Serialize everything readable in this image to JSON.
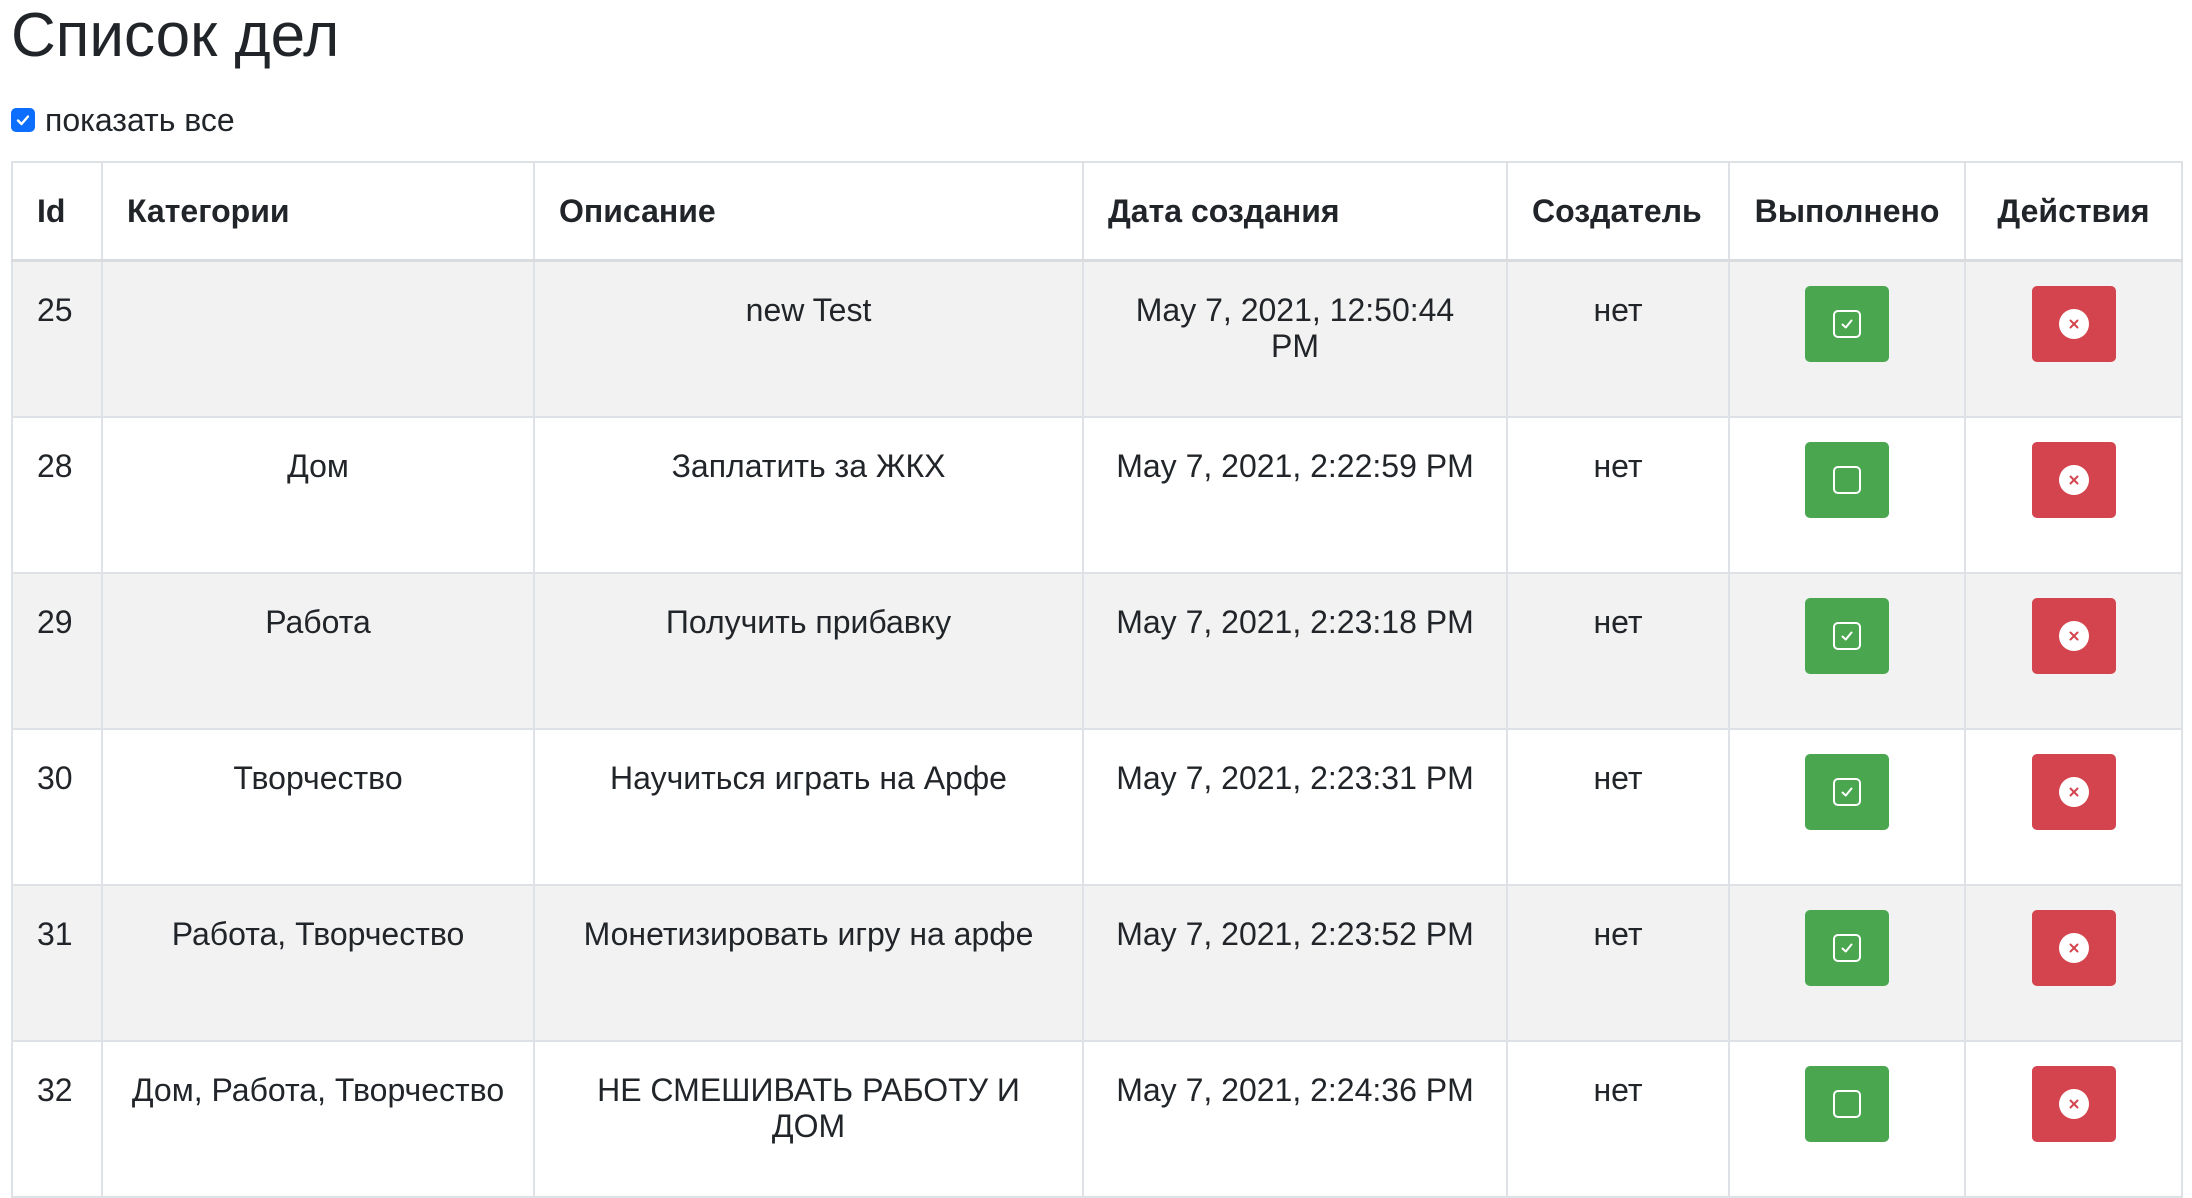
{
  "page_title": "Список дел",
  "show_all": {
    "label": "показать все",
    "checked": true
  },
  "table": {
    "headers": [
      "Id",
      "Категории",
      "Описание",
      "Дата создания",
      "Создатель",
      "Выполнено",
      "Действия"
    ],
    "rows": [
      {
        "id": "25",
        "categories": "",
        "description": "new Test",
        "created": "May 7, 2021, 12:50:44 PM",
        "creator": "нет",
        "done": true
      },
      {
        "id": "28",
        "categories": "Дом",
        "description": "Заплатить за ЖКХ",
        "created": "May 7, 2021, 2:22:59 PM",
        "creator": "нет",
        "done": false
      },
      {
        "id": "29",
        "categories": "Работа",
        "description": "Получить прибавку",
        "created": "May 7, 2021, 2:23:18 PM",
        "creator": "нет",
        "done": true
      },
      {
        "id": "30",
        "categories": "Творчество",
        "description": "Научиться играть на Арфе",
        "created": "May 7, 2021, 2:23:31 PM",
        "creator": "нет",
        "done": true
      },
      {
        "id": "31",
        "categories": "Работа, Творчество",
        "description": "Монетизировать игру на арфе",
        "created": "May 7, 2021, 2:23:52 PM",
        "creator": "нет",
        "done": true
      },
      {
        "id": "32",
        "categories": "Дом, Работа, Творчество",
        "description": "НЕ СМЕШИВАТЬ РАБОТУ И ДОМ",
        "created": "May 7, 2021, 2:24:36 PM",
        "creator": "нет",
        "done": false
      }
    ]
  },
  "icons": {
    "done_checked": "check-square-icon",
    "done_unchecked": "square-icon",
    "delete": "x-circle-icon"
  },
  "colors": {
    "success": "#4aa750",
    "danger": "#d4444e",
    "checkbox": "#0d6efd"
  }
}
